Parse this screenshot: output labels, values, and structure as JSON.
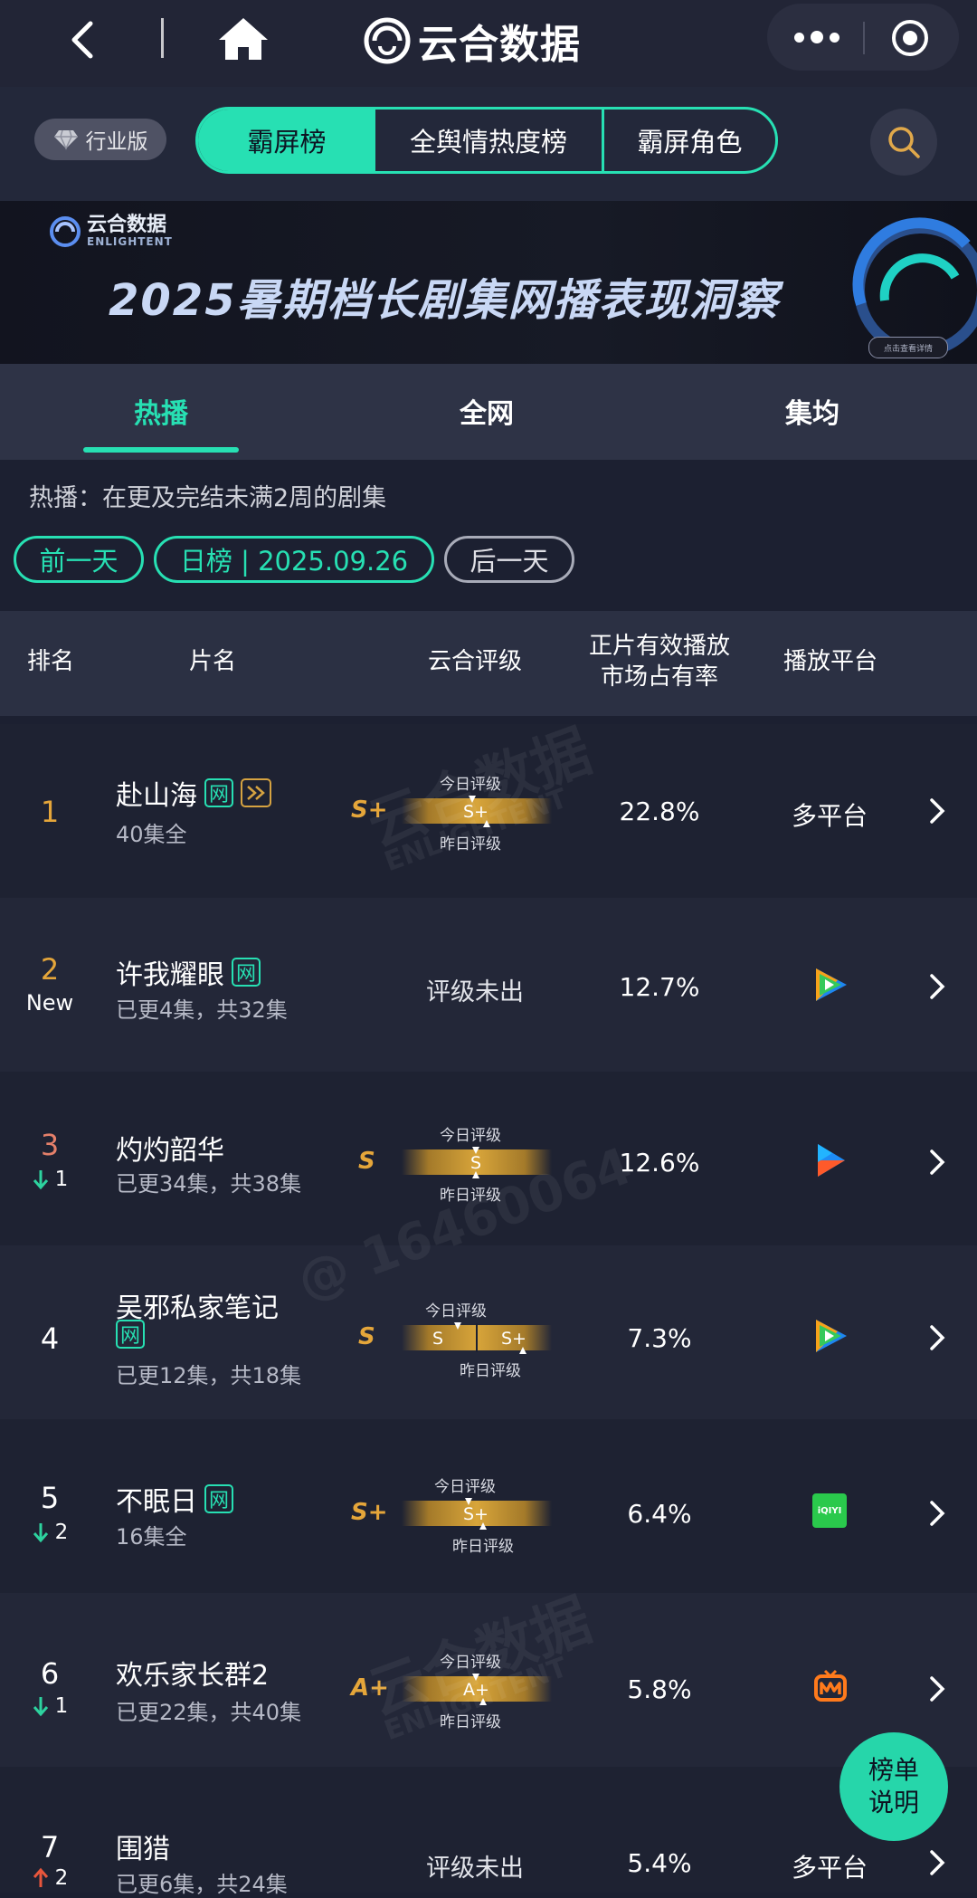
{
  "app": {
    "brand": "云合数据"
  },
  "header": {
    "edition": "行业版",
    "segments": [
      "霸屏榜",
      "全舆情热度榜",
      "霸屏角色"
    ]
  },
  "banner": {
    "logo_name": "云合数据",
    "logo_sub": "ENLIGHTENT",
    "title": "2025暑期档长剧集网播表现洞察",
    "button": "点击查看详情"
  },
  "subtabs": [
    "热播",
    "全网",
    "集均"
  ],
  "description": "热播：在更及完结未满2周的剧集",
  "date_nav": {
    "prev": "前一天",
    "current": "日榜 | 2025.09.26",
    "next": "后一天"
  },
  "columns": {
    "rank": "排名",
    "title": "片名",
    "grade": "云合评级",
    "share_line1": "正片有效播放",
    "share_line2": "市场占有率",
    "platform": "播放平台"
  },
  "grade_labels": {
    "today": "今日评级",
    "yesterday": "昨日评级",
    "none": "评级未出"
  },
  "rows": [
    {
      "rank": "1",
      "change": "",
      "title": "赴山海",
      "eps": "40集全",
      "grade": "S+",
      "today": "",
      "yesterday": "S+",
      "share": "22.8%",
      "platform": "多平台"
    },
    {
      "rank": "2",
      "change": "New",
      "title": "许我耀眼",
      "eps": "已更4集，共32集",
      "grade": "",
      "share": "12.7%",
      "platform": "tencent-video-icon"
    },
    {
      "rank": "3",
      "change": "1",
      "title": "灼灼韶华",
      "eps": "已更34集，共38集",
      "grade": "S",
      "today": "",
      "yesterday": "S",
      "share": "12.6%",
      "platform": "youku-icon"
    },
    {
      "rank": "4",
      "change": "",
      "title": "吴邪私家笔记",
      "eps": "已更12集，共18集",
      "grade": "S",
      "today": "S",
      "yesterday": "S+",
      "share": "7.3%",
      "platform": "tencent-video-icon"
    },
    {
      "rank": "5",
      "change": "2",
      "title": "不眠日",
      "eps": "16集全",
      "grade": "S+",
      "today": "",
      "yesterday": "S+",
      "share": "6.4%",
      "platform": "iqiyi-icon"
    },
    {
      "rank": "6",
      "change": "1",
      "title": "欢乐家长群2",
      "eps": "已更22集，共40集",
      "grade": "A+",
      "today": "",
      "yesterday": "A+",
      "share": "5.8%",
      "platform": "mango-tv-icon"
    },
    {
      "rank": "7",
      "change": "2",
      "title": "围猎",
      "eps": "已更6集，共24集",
      "grade": "",
      "share": "5.4%",
      "platform": "多平台"
    }
  ],
  "iqiyi_logo": "iQIYI",
  "watermark": {
    "brand": "云合数据",
    "sub": "ENLIGHTENT",
    "user": "@ 16460064"
  },
  "fab": {
    "line1": "榜单",
    "line2": "说明"
  },
  "colors": {
    "accent": "#27e0b3",
    "gold": "#e5a63a",
    "down": "#2dd39f",
    "up": "#e8563c",
    "background": "#1c2031"
  }
}
